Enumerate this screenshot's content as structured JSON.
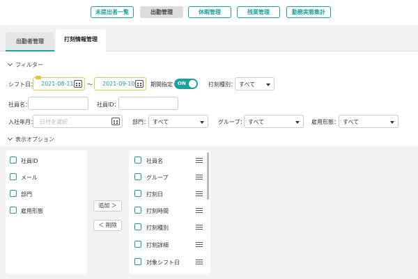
{
  "topnav": {
    "items": [
      {
        "label": "未提出者一覧",
        "active": false
      },
      {
        "label": "出勤管理",
        "active": true
      },
      {
        "label": "休暇管理",
        "active": false
      },
      {
        "label": "残業管理",
        "active": false
      },
      {
        "label": "勤務実態集計",
        "active": false
      }
    ]
  },
  "tabs": [
    {
      "label": "出勤者管理",
      "active": false
    },
    {
      "label": "打刻情報管理",
      "active": true
    }
  ],
  "filter": {
    "section_title": "フィルター",
    "shift_date_label": "シフト日：",
    "date_from": "2021-08-11",
    "date_separator": "～",
    "date_to": "2021-09-10",
    "period_label": "期間指定",
    "period_toggle": "ON",
    "stamp_type_label": "打刻種別：",
    "stamp_type_value": "すべて",
    "employee_name_label": "社員名：",
    "employee_name_value": "",
    "employee_id_label": "社員ID：",
    "employee_id_value": "",
    "hire_month_label": "入社年月：",
    "hire_month_placeholder": "日付を選択",
    "department_label": "部門：",
    "department_value": "すべて",
    "group_label": "グループ：",
    "group_value": "すべて",
    "employment_label": "雇用形態：",
    "employment_value": "すべて"
  },
  "display_options": {
    "section_title": "表示オプション",
    "available": [
      "社員ID",
      "メール",
      "部門",
      "雇用形態"
    ],
    "add_label": "追加 ＞",
    "remove_label": "＜ 削除",
    "selected": [
      "社員名",
      "グループ",
      "打刻日",
      "打刻時間",
      "打刻種別",
      "打刻詳細",
      "対象シフト日"
    ]
  },
  "colors": {
    "accent": "#1aa39a",
    "date_border": "#e6c84a"
  }
}
